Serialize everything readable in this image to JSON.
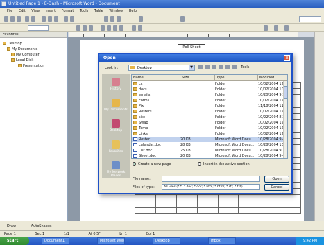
{
  "app": {
    "title": "Untitled Page 1 - E-Dash - Microsoft Word - Document"
  },
  "menu": [
    "File",
    "Edit",
    "View",
    "Insert",
    "Format",
    "Tools",
    "Table",
    "Window",
    "Help"
  ],
  "toolbar": {
    "style_value": "Normal",
    "help_placeholder": "Type a question"
  },
  "nav_pane": {
    "header": "Favorites",
    "items": [
      "Desktop",
      "My Documents",
      "My Computer",
      "Local Disk",
      "Presentation"
    ]
  },
  "document": {
    "header_text": "Roll Sheet"
  },
  "dialog": {
    "title": "Open",
    "look_in_label": "Look in:",
    "look_in_value": "Desktop",
    "tools_label": "Tools",
    "places": [
      "History",
      "My Documents",
      "Desktop",
      "Favorites",
      "My Network Places"
    ],
    "columns": [
      "Name",
      "Size",
      "Type",
      "Modified"
    ],
    "files": [
      {
        "name": "cc",
        "size": "",
        "type": "Folder",
        "modified": "10/02/2004 12:18 PM",
        "kind": "folder"
      },
      {
        "name": "docs",
        "size": "",
        "type": "Folder",
        "modified": "10/02/2004 10:15 PM",
        "kind": "folder"
      },
      {
        "name": "emails",
        "size": "",
        "type": "Folder",
        "modified": "10/20/2004 9:36 PM",
        "kind": "folder"
      },
      {
        "name": "Forms",
        "size": "",
        "type": "Folder",
        "modified": "10/02/2004 12:19 PM",
        "kind": "folder"
      },
      {
        "name": "Pix",
        "size": "",
        "type": "Folder",
        "modified": "11/18/2004 11:14 AM",
        "kind": "folder"
      },
      {
        "name": "Rosters",
        "size": "",
        "type": "Folder",
        "modified": "10/02/2004 12:19 PM",
        "kind": "folder"
      },
      {
        "name": "site",
        "size": "",
        "type": "Folder",
        "modified": "10/22/2004 8:26 PM",
        "kind": "folder"
      },
      {
        "name": "Swap",
        "size": "",
        "type": "Folder",
        "modified": "10/02/2004 12:19 PM",
        "kind": "folder"
      },
      {
        "name": "Temp",
        "size": "",
        "type": "Folder",
        "modified": "10/02/2004 12:20 PM",
        "kind": "folder"
      },
      {
        "name": "Links",
        "size": "",
        "type": "Folder",
        "modified": "10/02/2004 12:20 PM",
        "kind": "folder"
      },
      {
        "name": "Roster",
        "size": "20 KB",
        "type": "Microsoft Word Docu...",
        "modified": "10/28/2004 9:40 PM",
        "kind": "doc"
      },
      {
        "name": "calendar.doc",
        "size": "28 KB",
        "type": "Microsoft Word Docu...",
        "modified": "10/28/2004 10:13 PM",
        "kind": "doc"
      },
      {
        "name": "List.doc",
        "size": "25 KB",
        "type": "Microsoft Word Docu...",
        "modified": "10/28/2004 9:32 PM",
        "kind": "doc"
      },
      {
        "name": "Sheet.doc",
        "size": "20 KB",
        "type": "Microsoft Word Docu...",
        "modified": "10/28/2004 9:41 PM",
        "kind": "doc"
      }
    ],
    "radio_open": "Create a new page",
    "radio_active": "Insert in the active section",
    "file_name_label": "File name:",
    "file_name_value": "",
    "file_type_label": "Files of type:",
    "file_type_value": "All Files (*.*; *.doc; *.dot; *.htm; *.html; *.rtf; *.txt)",
    "open_button": "Open",
    "cancel_button": "Cancel"
  },
  "statusbar": {
    "page": "Page 1",
    "sec": "Sec 1",
    "pos": "1/1",
    "at": "At 0.5\"",
    "ln": "Ln 1",
    "col": "Col 1"
  },
  "taskbar": {
    "start_label": "start",
    "items": [
      "Document1",
      "Microsoft Word",
      "Desktop",
      "Inbox"
    ],
    "clock": "9:42 PM"
  },
  "drawbar": {
    "draw_label": "Draw",
    "autoshapes_label": "AutoShapes"
  },
  "colors": {
    "titlebar": "#2a5fc0",
    "dialog_border": "#1f52c8",
    "selection": "#c1d2ee"
  }
}
